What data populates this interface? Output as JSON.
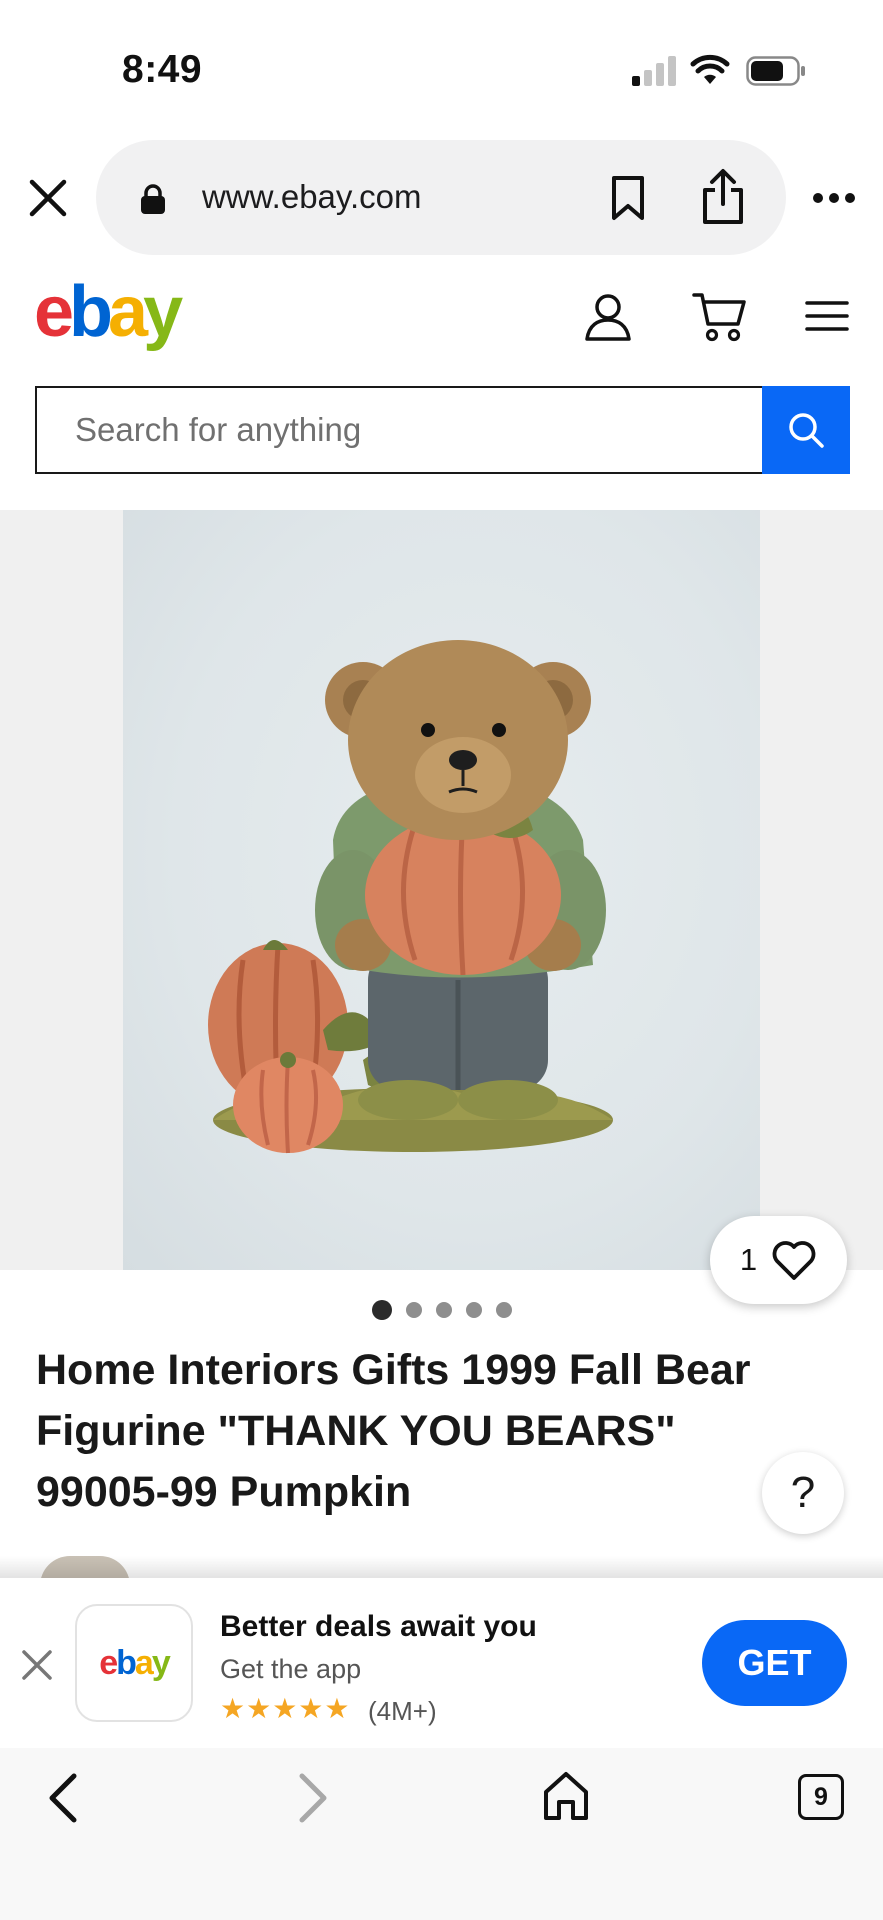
{
  "status_bar": {
    "time": "8:49"
  },
  "browser": {
    "url": "www.ebay.com"
  },
  "header": {
    "logo_letters": [
      "e",
      "b",
      "a",
      "y"
    ],
    "logo_colors": [
      "#e53238",
      "#0064d2",
      "#f5af02",
      "#86b817"
    ]
  },
  "search": {
    "placeholder": "Search for anything"
  },
  "listing": {
    "watch_count": "1",
    "image_index": 1,
    "image_total": 5,
    "title": "Home Interiors Gifts 1999 Fall Bear Figurine \"THANK YOU BEARS\" 99005-99 Pumpkin",
    "help_label": "?"
  },
  "app_banner": {
    "title": "Better deals await you",
    "subtitle": "Get the app",
    "stars": "★★★★★",
    "rating_count": "(4M+)",
    "get_label": "GET"
  },
  "toolbar": {
    "tab_count": "9"
  },
  "colors": {
    "accent_blue": "#0968f6",
    "star": "#f5a623"
  }
}
